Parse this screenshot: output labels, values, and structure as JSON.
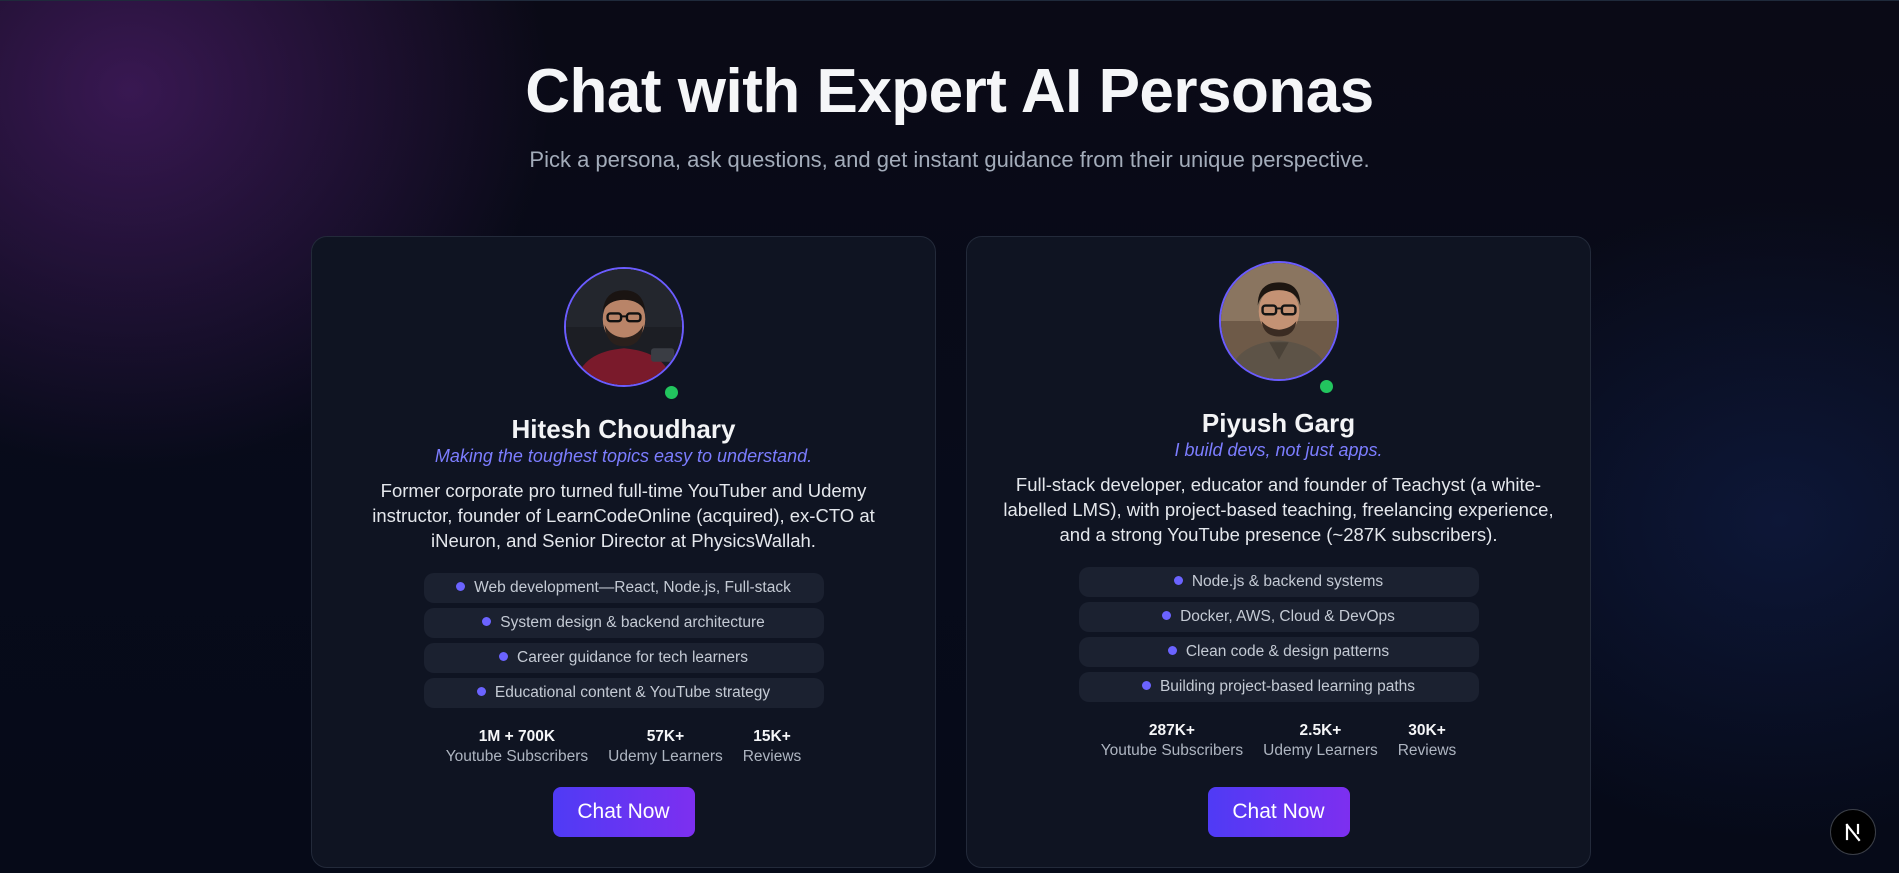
{
  "hero": {
    "title": "Chat with Expert AI Personas",
    "subtitle": "Pick a persona, ask questions, and get instant guidance from their unique perspective."
  },
  "personas": [
    {
      "name": "Hitesh Choudhary",
      "tagline": "Making the toughest topics easy to understand.",
      "bio_lines": [
        "Former corporate pro turned full-time YouTuber and Udemy",
        "instructor, founder of LearnCodeOnline (acquired), ex-CTO at",
        "iNeuron, and Senior Director at PhysicsWallah."
      ],
      "skills": [
        "Web development—React, Node.js, Full-stack",
        "System design & backend architecture",
        "Career guidance for tech learners",
        "Educational content & YouTube strategy"
      ],
      "stats": [
        {
          "value": "1M + 700K",
          "label": "Youtube Subscribers"
        },
        {
          "value": "57K+",
          "label": "Udemy Learners"
        },
        {
          "value": "15K+",
          "label": "Reviews"
        }
      ],
      "cta": "Chat Now",
      "online": true
    },
    {
      "name": "Piyush Garg",
      "tagline": "I build devs, not just apps.",
      "bio_lines": [
        "Full-stack developer, educator and founder of Teachyst (a white-",
        "labelled LMS), with project-based teaching, freelancing experience,",
        "and a strong YouTube presence (~287K subscribers)."
      ],
      "skills": [
        "Node.js & backend systems",
        "Docker, AWS, Cloud & DevOps",
        "Clean code & design patterns",
        "Building project-based learning paths"
      ],
      "stats": [
        {
          "value": "287K+",
          "label": "Youtube Subscribers"
        },
        {
          "value": "2.5K+",
          "label": "Udemy Learners"
        },
        {
          "value": "30K+",
          "label": "Reviews"
        }
      ],
      "cta": "Chat Now",
      "online": true
    }
  ],
  "badge": {
    "icon": "nextjs-logo-icon",
    "letter": "N"
  },
  "colors": {
    "accent": "#6b5cff",
    "tagline": "#7c7dff",
    "online": "#22c55e",
    "button_start": "#4f3bf5",
    "button_end": "#7d2ff0",
    "card_bg": "#0f1422"
  }
}
